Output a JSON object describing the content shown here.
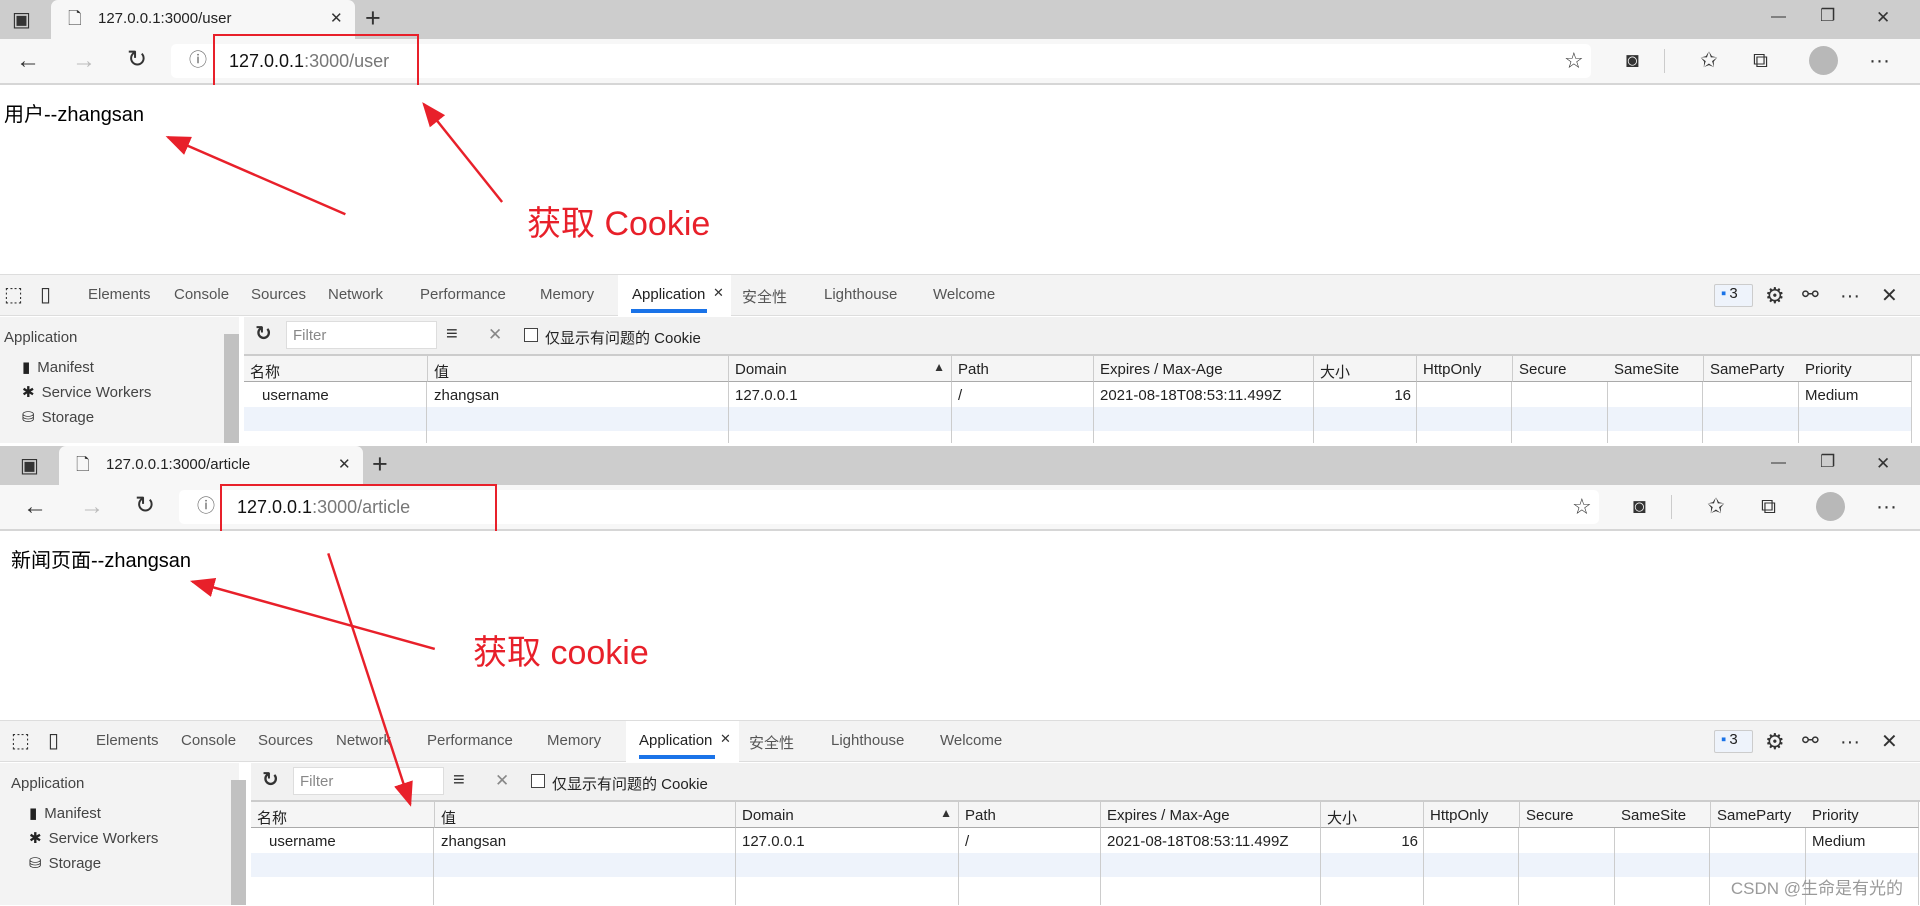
{
  "colors": {
    "annotation": "#e8202a",
    "accent": "#1a73e8",
    "tabbar": "#cdcdcd",
    "selected_row": "#eef3fb"
  },
  "windows": [
    {
      "tab_title": "127.0.0.1:3000/user",
      "url_host": "127.0.0.1",
      "url_path": ":3000/user",
      "page_text": "用户--zhangsan",
      "annotation": "获取 Cookie"
    },
    {
      "tab_title": "127.0.0.1:3000/article",
      "url_host": "127.0.0.1",
      "url_path": ":3000/article",
      "page_text": "新闻页面--zhangsan",
      "annotation": "获取 cookie"
    }
  ],
  "browser": {
    "icons": {
      "back": "arrow-left-icon",
      "forward": "arrow-right-icon",
      "refresh": "refresh-icon",
      "info": "info-icon",
      "favorite": "star-add-icon",
      "collections": "collections-icon",
      "profile": "avatar",
      "more": "more-icon"
    },
    "new_tab": "+",
    "more": "···"
  },
  "devtools": {
    "tabs": [
      "Elements",
      "Console",
      "Sources",
      "Network",
      "Performance",
      "Memory",
      "Application",
      "安全性",
      "Lighthouse",
      "Welcome"
    ],
    "active_tab": "Application",
    "issues_count": "3",
    "sidebar": {
      "title": "Application",
      "items": [
        {
          "label": "Manifest",
          "icon": "file-icon"
        },
        {
          "label": "Service Workers",
          "icon": "gear-icon"
        },
        {
          "label": "Storage",
          "icon": "database-icon"
        }
      ]
    },
    "toolbar": {
      "filter_placeholder": "Filter",
      "checkbox_label": "仅显示有问题的 Cookie",
      "checked": false
    },
    "cookie_table": {
      "columns": [
        "名称",
        "值",
        "Domain",
        "Path",
        "Expires / Max-Age",
        "大小",
        "HttpOnly",
        "Secure",
        "SameSite",
        "SameParty",
        "Priority"
      ],
      "sorted_column": "Domain",
      "rows": [
        [
          "username",
          "zhangsan",
          "127.0.0.1",
          "/",
          "2021-08-18T08:53:11.499Z",
          "16",
          "",
          "",
          "",
          "",
          "Medium"
        ]
      ]
    }
  },
  "watermark": "CSDN @生命是有光的"
}
